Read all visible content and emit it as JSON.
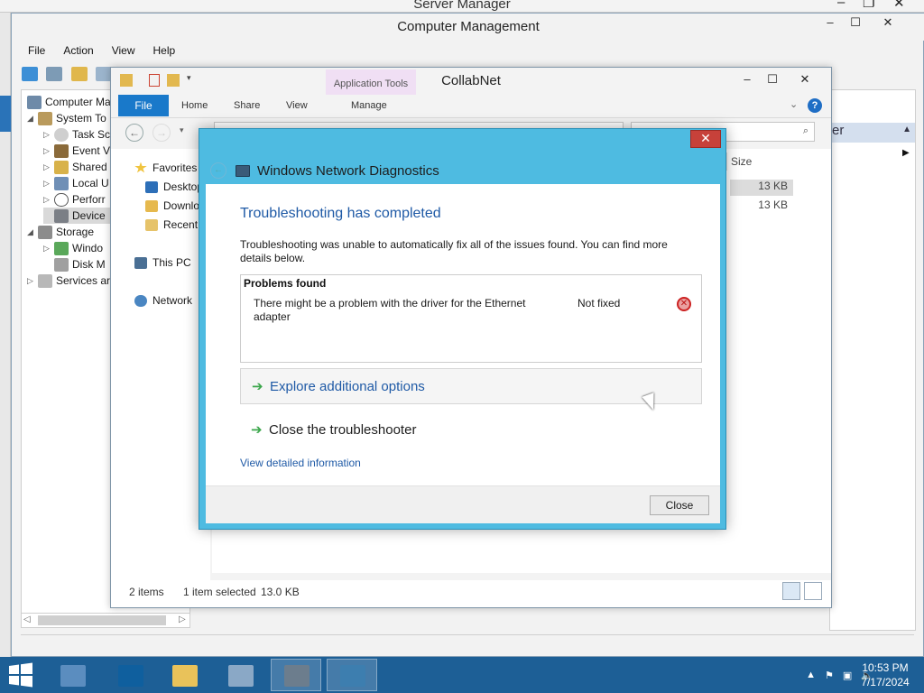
{
  "server_manager": {
    "title": "Server Manager",
    "controls": [
      "–",
      "❐",
      "✕"
    ]
  },
  "computer_management": {
    "title": "Computer Management",
    "controls": [
      "–",
      "☐",
      "✕"
    ],
    "menu": [
      "File",
      "Action",
      "View",
      "Help"
    ],
    "tree": [
      {
        "label": "Computer Ma",
        "arrow": "",
        "icon": "computer-icon"
      },
      {
        "label": "System To",
        "arrow": "◢",
        "icon": "tools-icon"
      },
      {
        "label": "Task Sc",
        "arrow": "▷",
        "icon": "clock-icon"
      },
      {
        "label": "Event V",
        "arrow": "▷",
        "icon": "event-viewer-icon"
      },
      {
        "label": "Shared",
        "arrow": "▷",
        "icon": "shared-folder-icon"
      },
      {
        "label": "Local U",
        "arrow": "▷",
        "icon": "users-icon"
      },
      {
        "label": "Perforr",
        "arrow": "▷",
        "icon": "performance-icon"
      },
      {
        "label": "Device",
        "arrow": "",
        "icon": "device-manager-icon"
      },
      {
        "label": "Storage",
        "arrow": "◢",
        "icon": "storage-icon"
      },
      {
        "label": "Windo",
        "arrow": "▷",
        "icon": "backup-icon"
      },
      {
        "label": "Disk M",
        "arrow": "",
        "icon": "disk-icon"
      },
      {
        "label": "Services ar",
        "arrow": "▷",
        "icon": "services-icon"
      }
    ],
    "actions_header": "er"
  },
  "explorer": {
    "title": "CollabNet",
    "context_tab": "Application Tools",
    "tabs": [
      "File",
      "Home",
      "Share",
      "View",
      "Manage"
    ],
    "controls": [
      "–",
      "☐",
      "✕"
    ],
    "nav": [
      {
        "label": "Favorites",
        "icon": "star-icon"
      },
      {
        "label": "Desktop",
        "icon": "desktop-icon"
      },
      {
        "label": "Downlo",
        "icon": "downloads-icon"
      },
      {
        "label": "Recent",
        "icon": "recent-icon"
      },
      {
        "label": "This PC",
        "icon": "pc-icon"
      },
      {
        "label": "Network",
        "icon": "network-icon"
      }
    ],
    "column_size": "Size",
    "sizes": [
      "13 KB",
      "13 KB"
    ],
    "status": {
      "items": "2 items",
      "selected": "1 item selected",
      "size": "13.0 KB"
    }
  },
  "dialog": {
    "title": "Windows Network Diagnostics",
    "heading": "Troubleshooting has completed",
    "description": "Troubleshooting was unable to automatically fix all of the issues found. You can find more details below.",
    "problems_label": "Problems found",
    "problem": {
      "text": "There might be a problem with the driver for the Ethernet adapter",
      "status": "Not fixed"
    },
    "option_explore": "Explore additional options",
    "option_close": "Close the troubleshooter",
    "details_link": "View detailed information",
    "close_button": "Close",
    "close_x": "✕"
  },
  "taskbar": {
    "apps": [
      "server-manager",
      "powershell",
      "file-explorer",
      "control-panel",
      "network-app",
      "network-diagnostics"
    ],
    "time": "10:53 PM",
    "date": "7/17/2024"
  }
}
